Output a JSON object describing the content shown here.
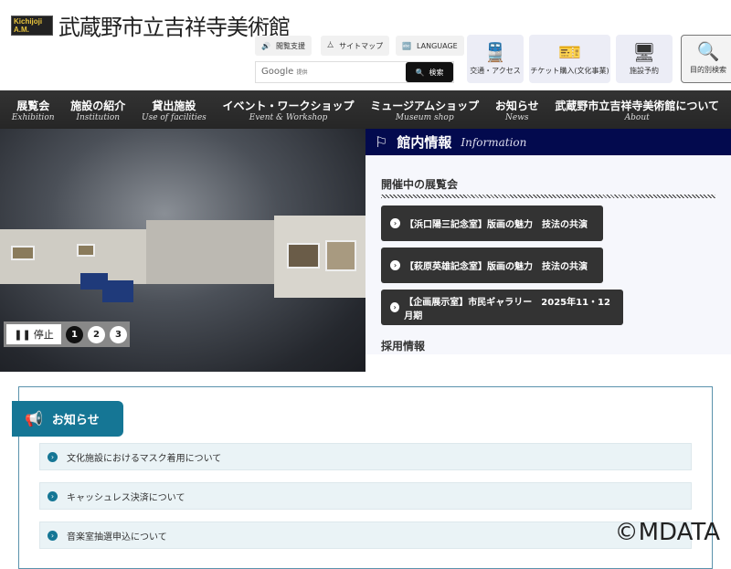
{
  "header": {
    "logo_mark": "Kichijoji A.M.",
    "title": "武蔵野市立吉祥寺美術館"
  },
  "utility": [
    {
      "label": "閲覧支援",
      "icon": "speaker-icon"
    },
    {
      "label": "サイトマップ",
      "icon": "sitemap-icon"
    },
    {
      "label": "LANGUAGE",
      "icon": "language-icon"
    }
  ],
  "search": {
    "placeholder_brand": "Google",
    "placeholder_suffix": "提供",
    "button": "検索"
  },
  "quick_links": [
    {
      "label": "交通・アクセス",
      "icon": "train-icon"
    },
    {
      "label": "チケット購入(文化事業)",
      "icon": "ticket-icon"
    },
    {
      "label": "施設予約",
      "icon": "monitor-icon"
    },
    {
      "label": "目的別検索",
      "icon": "search-icon"
    }
  ],
  "nav": [
    {
      "jp": "展覧会",
      "en": "Exhibition"
    },
    {
      "jp": "施設の紹介",
      "en": "Institution"
    },
    {
      "jp": "貸出施設",
      "en": "Use of facilities"
    },
    {
      "jp": "イベント・ワークショップ",
      "en": "Event & Workshop"
    },
    {
      "jp": "ミュージアムショップ",
      "en": "Museum shop"
    },
    {
      "jp": "お知らせ",
      "en": "News"
    },
    {
      "jp": "武蔵野市立吉祥寺美術館について",
      "en": "About"
    }
  ],
  "slider": {
    "stop_label": "停止",
    "pages": [
      "1",
      "2",
      "3"
    ],
    "current": 1
  },
  "info": {
    "title": "館内情報",
    "title_en": "Information",
    "current_heading": "開催中の展覧会",
    "exhibitions": [
      "【浜口陽三記念室】版画の魅力　技法の共演",
      "【萩原英雄記念室】版画の魅力　技法の共演",
      "【企画展示室】市民ギャラリー　2025年11・12月期"
    ],
    "recruit_heading": "採用情報"
  },
  "news": {
    "title": "お知らせ",
    "items": [
      "文化施設におけるマスク着用について",
      "キャッシュレス決済について",
      "音楽室抽選申込について"
    ]
  },
  "watermark": "©MDATA"
}
